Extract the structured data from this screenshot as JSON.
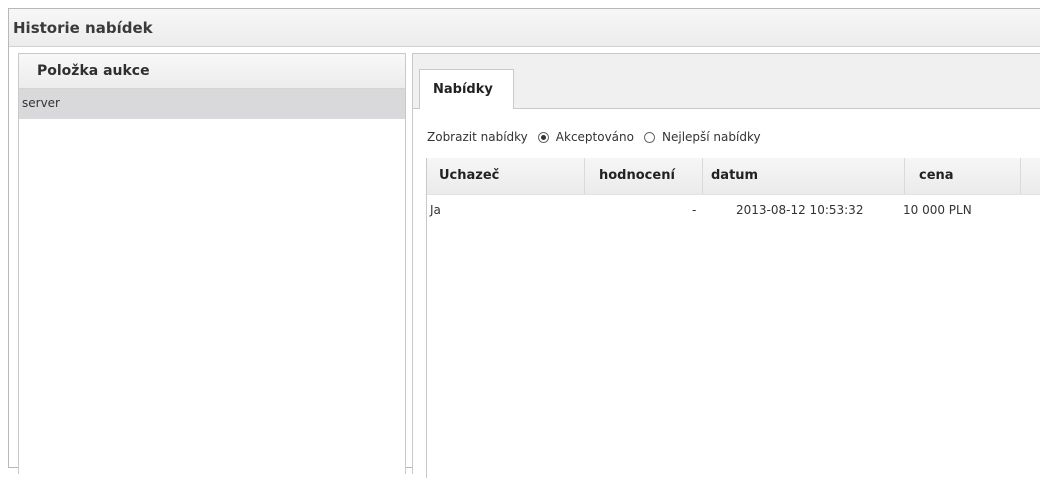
{
  "window": {
    "title": "Historie nabídek"
  },
  "left": {
    "header": "Položka aukce",
    "items": [
      {
        "label": "server"
      }
    ]
  },
  "tabs": [
    {
      "label": "Nabídky"
    }
  ],
  "filter": {
    "label": "Zobrazit nabídky",
    "options": [
      {
        "label": "Akceptováno",
        "checked": true
      },
      {
        "label": "Nejlepší nabídky",
        "checked": false
      }
    ]
  },
  "grid": {
    "columns": [
      "Uchazeč",
      "hodnocení",
      "datum",
      "cena"
    ],
    "rows": [
      {
        "bidder": "Ja",
        "rating": "-",
        "date": "2013-08-12 10:53:32",
        "price": "10 000 PLN"
      }
    ]
  }
}
